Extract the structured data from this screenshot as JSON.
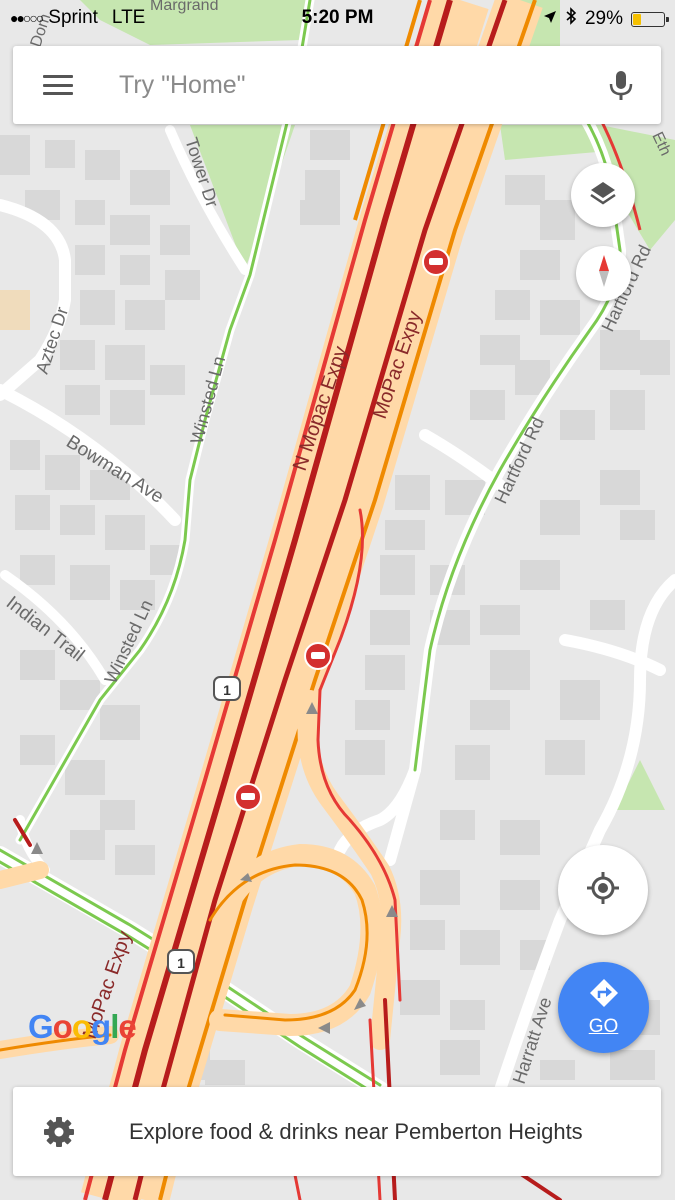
{
  "status_bar": {
    "carrier": "Sprint",
    "network": "LTE",
    "time": "5:20 PM",
    "battery": "29%",
    "battery_level": 0.29
  },
  "search": {
    "placeholder": "Try \"Home\""
  },
  "map": {
    "street_labels": [
      "N Mopac Expy",
      "MoPac Expy",
      "MoPac Expy",
      "Tower Dr",
      "Aztec Dr",
      "Winsted Ln",
      "Winsted Ln",
      "Bowman Ave",
      "Indian Trail",
      "Hartford Rd",
      "Hartford Rd",
      "Harratt Ave",
      "Margrand",
      "Dom",
      "Eth"
    ],
    "route_shields": [
      "1",
      "1"
    ],
    "incident_icon": "crash-incident-icon"
  },
  "controls": {
    "layers_icon": "layers-icon",
    "compass_icon": "compass-icon",
    "my_location_icon": "my-location-icon",
    "go_label": "GO"
  },
  "branding": {
    "logo_text": "Google"
  },
  "explore": {
    "text": "Explore food & drinks near Pemberton Heights"
  },
  "colors": {
    "traffic_heavy": "#b71c1c",
    "traffic_slow": "#e53935",
    "traffic_medium": "#ef8a00",
    "traffic_clear": "#7cc94f",
    "highway_fill": "#ffd9a8",
    "go_button": "#4285f4",
    "park": "#c6e6b0"
  }
}
